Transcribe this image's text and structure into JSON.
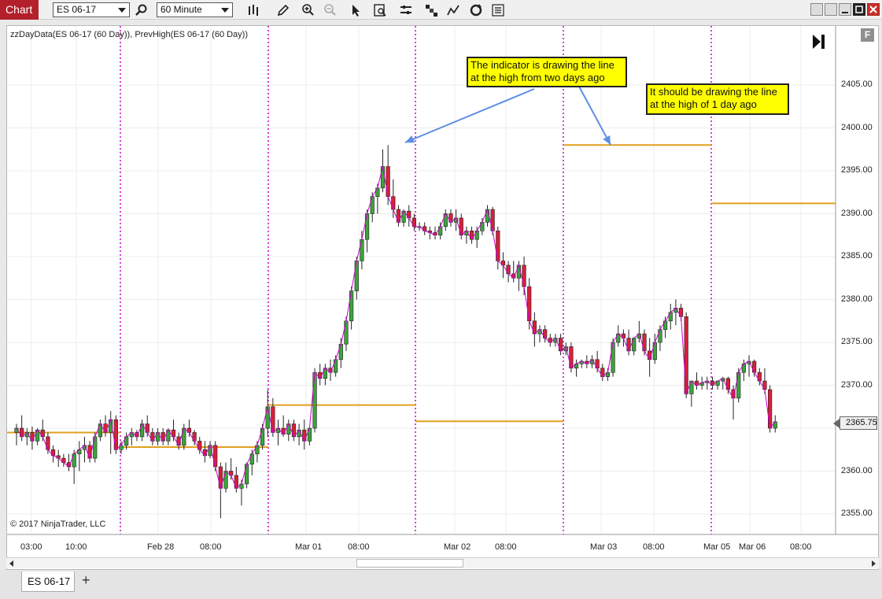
{
  "toolbar": {
    "title": "Chart",
    "instrument": "ES 06-17",
    "interval": "60 Minute",
    "icons": [
      "search-icon",
      "bar-type-icon",
      "pencil-icon",
      "zoom-in-icon",
      "zoom-out-icon",
      "pointer-icon",
      "data-box-icon",
      "properties-icon",
      "strategies-icon",
      "indicators-icon",
      "refresh-icon",
      "toggle-list-icon"
    ]
  },
  "chart": {
    "indicator_label": "zzDayData(ES 06-17 (60 Day)), PrevHigh(ES 06-17 (60 Day))",
    "copyright": "© 2017 NinjaTrader, LLC",
    "f_button": "F",
    "last_price": "2365.75",
    "notes": {
      "note1": "The indicator is drawing the line at the high from two days ago",
      "note2": "It should be drawing the line at the high of 1 day ago"
    },
    "colors": {
      "up": "#3aa43a",
      "down": "#d8203a",
      "prev_high": "#e0a020",
      "session": "#cc00cc",
      "arrow": "#5b8ee6"
    }
  },
  "chart_data": {
    "type": "candlestick",
    "y_ticks": [
      "2405.00",
      "2400.00",
      "2395.00",
      "2390.00",
      "2385.00",
      "2380.00",
      "2375.00",
      "2370.00",
      "2365.00",
      "2360.00",
      "2355.00"
    ],
    "x_ticks": [
      "03:00",
      "10:00",
      "Feb 28",
      "08:00",
      "Mar 01",
      "08:00",
      "Mar 02",
      "08:00",
      "Mar 03",
      "08:00",
      "Mar 05",
      "Mar 06",
      "08:00"
    ],
    "ylim": [
      2353,
      2410
    ],
    "prev_high_levels": [
      {
        "segment": 1,
        "value": 2364.5
      },
      {
        "segment": 2,
        "value": 2362.8
      },
      {
        "segment": 3,
        "value": 2367.7
      },
      {
        "segment": 4,
        "value": 2365.8
      },
      {
        "segment": 5,
        "value": 2398.0
      },
      {
        "segment": 6,
        "value": 2391.2
      }
    ],
    "candles": [
      [
        2364.5,
        2365.5,
        2363.0,
        2365.0
      ],
      [
        2365.0,
        2366.5,
        2363.5,
        2364.0
      ],
      [
        2364.0,
        2365.0,
        2363.0,
        2364.5
      ],
      [
        2364.5,
        2365.2,
        2362.5,
        2363.5
      ],
      [
        2363.5,
        2365.0,
        2363.0,
        2364.8
      ],
      [
        2364.8,
        2366.0,
        2363.5,
        2364.0
      ],
      [
        2364.0,
        2364.5,
        2362.0,
        2362.5
      ],
      [
        2362.5,
        2363.0,
        2361.0,
        2361.8
      ],
      [
        2361.8,
        2362.5,
        2360.5,
        2361.5
      ],
      [
        2361.5,
        2362.0,
        2360.5,
        2361.0
      ],
      [
        2361.0,
        2362.0,
        2360.0,
        2360.5
      ],
      [
        2360.5,
        2362.5,
        2358.5,
        2362.0
      ],
      [
        2362.0,
        2363.5,
        2360.0,
        2362.5
      ],
      [
        2362.5,
        2364.0,
        2361.0,
        2363.0
      ],
      [
        2363.0,
        2363.5,
        2361.0,
        2361.5
      ],
      [
        2361.5,
        2364.5,
        2361.0,
        2364.0
      ],
      [
        2364.0,
        2366.0,
        2363.5,
        2365.5
      ],
      [
        2365.5,
        2366.5,
        2364.0,
        2364.5
      ],
      [
        2364.5,
        2367.0,
        2362.0,
        2366.0
      ],
      [
        2366.0,
        2366.5,
        2362.0,
        2362.5
      ],
      [
        2362.5,
        2363.5,
        2362.0,
        2363.0
      ],
      [
        2363.0,
        2364.5,
        2362.5,
        2364.0
      ],
      [
        2364.0,
        2365.0,
        2363.0,
        2364.5
      ],
      [
        2364.5,
        2364.8,
        2363.5,
        2364.0
      ],
      [
        2364.0,
        2366.0,
        2363.5,
        2365.5
      ],
      [
        2365.5,
        2366.5,
        2364.0,
        2364.5
      ],
      [
        2364.5,
        2365.0,
        2363.0,
        2363.5
      ],
      [
        2363.5,
        2365.0,
        2363.0,
        2364.5
      ],
      [
        2364.5,
        2365.0,
        2363.0,
        2363.5
      ],
      [
        2363.5,
        2365.0,
        2363.0,
        2364.8
      ],
      [
        2364.8,
        2366.0,
        2363.5,
        2364.0
      ],
      [
        2364.0,
        2364.5,
        2362.5,
        2363.0
      ],
      [
        2363.0,
        2365.5,
        2362.5,
        2365.0
      ],
      [
        2365.0,
        2366.0,
        2364.0,
        2364.5
      ],
      [
        2364.5,
        2364.8,
        2363.0,
        2363.5
      ],
      [
        2363.5,
        2364.0,
        2362.0,
        2362.5
      ],
      [
        2362.5,
        2363.5,
        2361.0,
        2361.8
      ],
      [
        2361.8,
        2363.5,
        2361.5,
        2363.0
      ],
      [
        2363.0,
        2363.5,
        2360.0,
        2360.5
      ],
      [
        2360.5,
        2361.0,
        2354.5,
        2358.0
      ],
      [
        2358.0,
        2361.0,
        2357.5,
        2360.0
      ],
      [
        2360.0,
        2361.5,
        2359.0,
        2359.5
      ],
      [
        2359.5,
        2360.5,
        2357.5,
        2358.0
      ],
      [
        2358.0,
        2359.0,
        2356.0,
        2358.5
      ],
      [
        2358.5,
        2361.0,
        2358.0,
        2360.8
      ],
      [
        2360.8,
        2362.5,
        2359.5,
        2362.0
      ],
      [
        2362.0,
        2363.5,
        2361.0,
        2363.0
      ],
      [
        2363.0,
        2365.5,
        2362.5,
        2365.0
      ],
      [
        2365.0,
        2369.5,
        2364.0,
        2367.5
      ],
      [
        2367.5,
        2368.5,
        2364.0,
        2364.5
      ],
      [
        2364.5,
        2366.0,
        2363.0,
        2365.0
      ],
      [
        2365.0,
        2366.5,
        2364.0,
        2364.3
      ],
      [
        2364.3,
        2366.0,
        2363.5,
        2365.5
      ],
      [
        2365.5,
        2366.0,
        2363.5,
        2364.0
      ],
      [
        2364.0,
        2365.5,
        2363.0,
        2364.8
      ],
      [
        2364.8,
        2366.0,
        2362.5,
        2363.5
      ],
      [
        2363.5,
        2365.0,
        2363.0,
        2365.0
      ],
      [
        2365.0,
        2372.0,
        2364.5,
        2371.5
      ],
      [
        2371.5,
        2372.5,
        2370.0,
        2370.8
      ],
      [
        2370.8,
        2372.5,
        2370.0,
        2372.0
      ],
      [
        2372.0,
        2373.0,
        2370.5,
        2371.5
      ],
      [
        2371.5,
        2373.5,
        2371.0,
        2373.0
      ],
      [
        2373.0,
        2375.5,
        2372.0,
        2374.8
      ],
      [
        2374.8,
        2378.0,
        2374.0,
        2377.5
      ],
      [
        2377.5,
        2381.5,
        2376.5,
        2381.0
      ],
      [
        2381.0,
        2385.0,
        2380.0,
        2384.5
      ],
      [
        2384.5,
        2388.0,
        2383.5,
        2387.0
      ],
      [
        2387.0,
        2390.5,
        2385.5,
        2390.0
      ],
      [
        2390.0,
        2392.5,
        2389.0,
        2392.0
      ],
      [
        2392.0,
        2393.5,
        2390.0,
        2393.0
      ],
      [
        2393.0,
        2397.5,
        2392.5,
        2395.5
      ],
      [
        2395.5,
        2398.0,
        2391.0,
        2392.0
      ],
      [
        2392.0,
        2394.0,
        2389.5,
        2390.5
      ],
      [
        2390.5,
        2391.0,
        2388.5,
        2389.0
      ],
      [
        2389.0,
        2390.5,
        2388.5,
        2390.3
      ],
      [
        2390.3,
        2391.0,
        2388.5,
        2389.5
      ],
      [
        2389.5,
        2390.0,
        2388.0,
        2388.5
      ],
      [
        2388.5,
        2389.0,
        2388.0,
        2388.5
      ],
      [
        2388.5,
        2389.0,
        2387.5,
        2388.0
      ],
      [
        2388.0,
        2388.5,
        2387.0,
        2387.8
      ],
      [
        2387.8,
        2388.5,
        2387.0,
        2387.5
      ],
      [
        2387.5,
        2389.0,
        2387.0,
        2388.5
      ],
      [
        2388.5,
        2390.5,
        2388.0,
        2390.0
      ],
      [
        2390.0,
        2390.5,
        2388.5,
        2389.0
      ],
      [
        2389.0,
        2390.5,
        2388.0,
        2389.5
      ],
      [
        2389.5,
        2390.0,
        2387.0,
        2387.5
      ],
      [
        2387.5,
        2388.5,
        2386.5,
        2388.0
      ],
      [
        2388.0,
        2388.5,
        2386.5,
        2387.0
      ],
      [
        2387.0,
        2388.5,
        2386.0,
        2388.0
      ],
      [
        2388.0,
        2389.5,
        2387.5,
        2389.0
      ],
      [
        2389.0,
        2391.0,
        2388.5,
        2390.5
      ],
      [
        2390.5,
        2390.8,
        2387.5,
        2388.0
      ],
      [
        2388.0,
        2388.5,
        2383.5,
        2384.5
      ],
      [
        2384.5,
        2385.5,
        2382.5,
        2384.0
      ],
      [
        2384.0,
        2384.5,
        2382.0,
        2383.0
      ],
      [
        2383.0,
        2384.5,
        2382.0,
        2382.5
      ],
      [
        2382.5,
        2384.5,
        2381.0,
        2384.0
      ],
      [
        2384.0,
        2385.0,
        2380.5,
        2381.5
      ],
      [
        2381.5,
        2382.5,
        2376.5,
        2377.5
      ],
      [
        2377.5,
        2378.5,
        2374.5,
        2376.0
      ],
      [
        2376.0,
        2377.0,
        2375.0,
        2376.5
      ],
      [
        2376.5,
        2377.0,
        2375.0,
        2375.5
      ],
      [
        2375.5,
        2376.0,
        2374.5,
        2375.0
      ],
      [
        2375.0,
        2376.0,
        2374.5,
        2375.5
      ],
      [
        2375.5,
        2376.0,
        2373.5,
        2374.0
      ],
      [
        2374.0,
        2375.0,
        2373.5,
        2374.5
      ],
      [
        2374.5,
        2375.0,
        2371.5,
        2372.0
      ],
      [
        2372.0,
        2373.0,
        2371.0,
        2372.5
      ],
      [
        2372.5,
        2373.0,
        2372.0,
        2372.8
      ],
      [
        2372.8,
        2373.5,
        2372.0,
        2372.5
      ],
      [
        2372.5,
        2373.5,
        2372.0,
        2373.0
      ],
      [
        2373.0,
        2374.0,
        2371.5,
        2372.0
      ],
      [
        2372.0,
        2372.5,
        2370.5,
        2371.0
      ],
      [
        2371.0,
        2372.0,
        2370.5,
        2371.5
      ],
      [
        2371.5,
        2375.5,
        2371.0,
        2375.0
      ],
      [
        2375.0,
        2377.0,
        2374.5,
        2376.0
      ],
      [
        2376.0,
        2376.5,
        2374.5,
        2375.5
      ],
      [
        2375.5,
        2376.5,
        2373.5,
        2374.0
      ],
      [
        2374.0,
        2375.5,
        2373.5,
        2375.5
      ],
      [
        2375.5,
        2377.5,
        2375.0,
        2376.0
      ],
      [
        2376.0,
        2376.5,
        2373.5,
        2374.0
      ],
      [
        2374.0,
        2375.5,
        2371.0,
        2373.0
      ],
      [
        2373.0,
        2376.0,
        2372.5,
        2375.0
      ],
      [
        2375.0,
        2377.0,
        2374.0,
        2376.5
      ],
      [
        2376.5,
        2378.0,
        2375.5,
        2377.5
      ],
      [
        2377.5,
        2379.5,
        2376.5,
        2378.5
      ],
      [
        2378.5,
        2380.0,
        2377.0,
        2379.0
      ],
      [
        2379.0,
        2379.5,
        2377.5,
        2378.0
      ],
      [
        2378.0,
        2378.5,
        2368.5,
        2369.0
      ],
      [
        2369.0,
        2370.0,
        2367.5,
        2370.5
      ],
      [
        2370.5,
        2371.5,
        2369.5,
        2370.0
      ],
      [
        2370.0,
        2371.0,
        2369.5,
        2370.3
      ],
      [
        2370.3,
        2371.0,
        2369.5,
        2370.5
      ],
      [
        2370.5,
        2371.0,
        2369.5,
        2370.0
      ],
      [
        2370.0,
        2370.5,
        2369.5,
        2370.5
      ],
      [
        2370.5,
        2371.0,
        2369.5,
        2370.8
      ],
      [
        2370.8,
        2371.0,
        2369.0,
        2369.5
      ],
      [
        2369.5,
        2370.0,
        2366.0,
        2368.5
      ],
      [
        2368.5,
        2372.0,
        2368.0,
        2371.5
      ],
      [
        2371.5,
        2373.0,
        2370.5,
        2372.5
      ],
      [
        2372.5,
        2373.5,
        2371.0,
        2372.8
      ],
      [
        2372.8,
        2373.0,
        2371.0,
        2371.5
      ],
      [
        2371.5,
        2372.0,
        2370.0,
        2370.5
      ],
      [
        2370.5,
        2372.0,
        2369.0,
        2369.5
      ],
      [
        2369.5,
        2370.0,
        2364.5,
        2365.0
      ],
      [
        2365.0,
        2366.5,
        2364.5,
        2365.75
      ]
    ]
  },
  "tabs": {
    "active": "ES 06-17",
    "add": "+"
  }
}
